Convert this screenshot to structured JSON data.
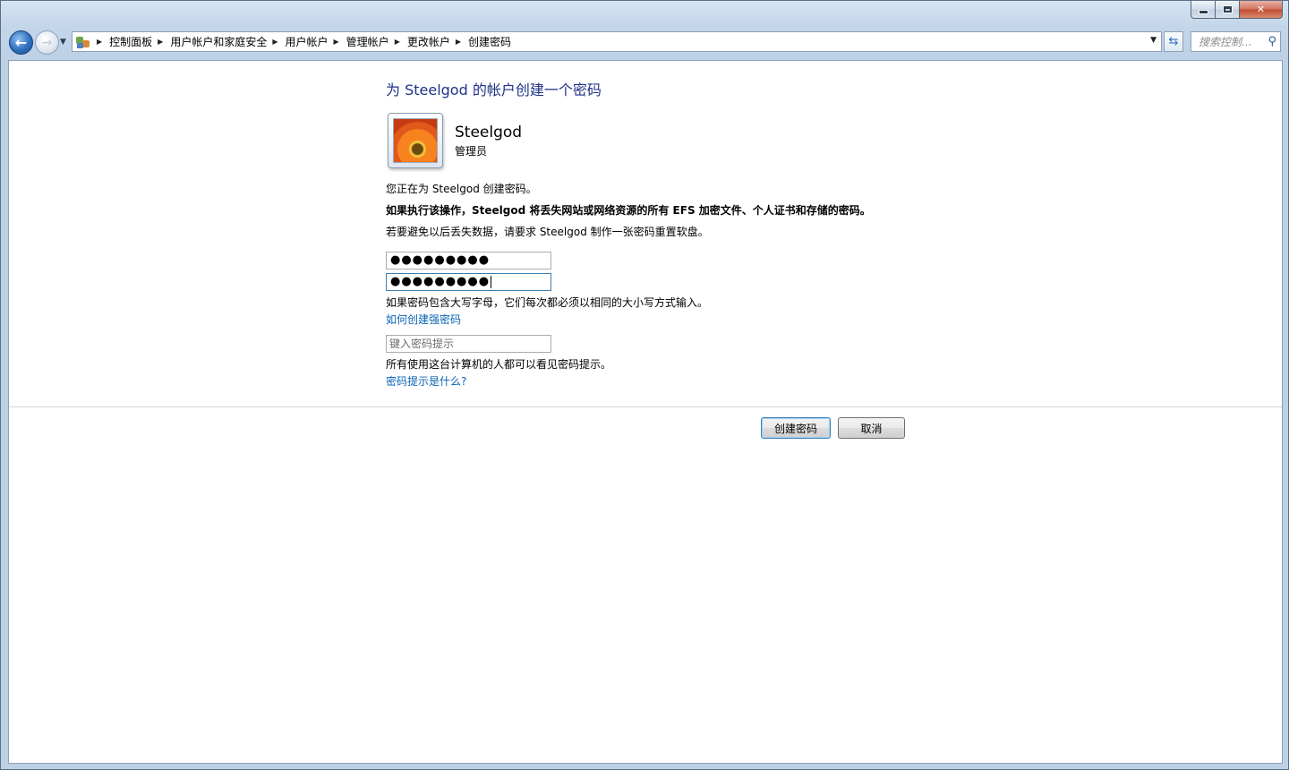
{
  "nav": {
    "breadcrumbs": [
      "控制面板",
      "用户帐户和家庭安全",
      "用户帐户",
      "管理帐户",
      "更改帐户",
      "创建密码"
    ],
    "search_placeholder": "搜索控制..."
  },
  "page": {
    "title": "为 Steelgod 的帐户创建一个密码",
    "user": {
      "name": "Steelgod",
      "role": "管理员"
    },
    "info_line": "您正在为 Steelgod 创建密码。",
    "warning_line": "如果执行该操作，Steelgod 将丢失网站或网络资源的所有 EFS 加密文件、个人证书和存储的密码。",
    "advice_line": "若要避免以后丢失数据，请要求 Steelgod 制作一张密码重置软盘。",
    "password_value": "●●●●●●●●●",
    "confirm_password_value": "●●●●●●●●●",
    "case_note": "如果密码包含大写字母，它们每次都必须以相同的大小写方式输入。",
    "strong_password_link": "如何创建强密码",
    "hint_placeholder": "键入密码提示",
    "hint_note": "所有使用这台计算机的人都可以看见密码提示。",
    "hint_link": "密码提示是什么?"
  },
  "buttons": {
    "create": "创建密码",
    "cancel": "取消"
  },
  "icons": {
    "back": "back-arrow-icon",
    "forward": "forward-arrow-icon",
    "refresh": "refresh-icon",
    "search": "search-icon",
    "control_panel": "control-panel-icon"
  }
}
